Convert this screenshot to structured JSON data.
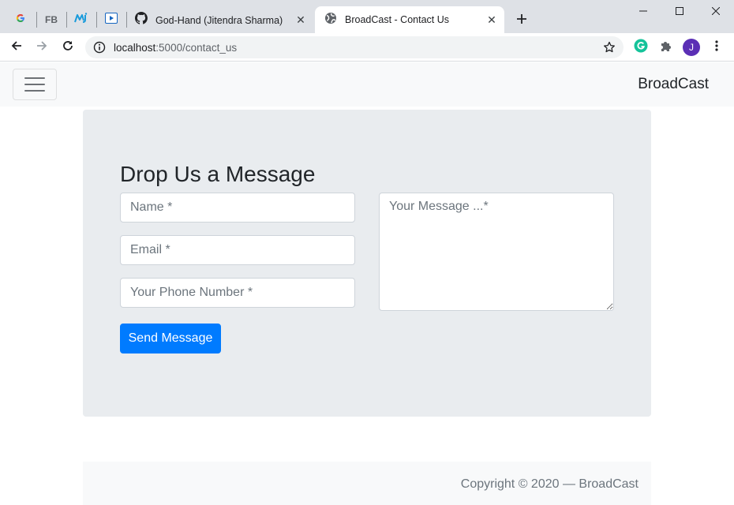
{
  "browser": {
    "pinned_tabs": [
      {
        "name": "google-tab-icon",
        "glyph": "G"
      },
      {
        "name": "fb-tab-icon",
        "glyph": "FB"
      },
      {
        "name": "mj-tab-icon",
        "glyph": "mj"
      },
      {
        "name": "video-tab-icon",
        "glyph": "▶"
      }
    ],
    "tabs": [
      {
        "title": "God-Hand (Jitendra Sharma)",
        "icon": "github-icon",
        "active": false
      },
      {
        "title": "BroadCast - Contact Us",
        "icon": "globe-icon",
        "active": true
      }
    ],
    "address": {
      "host": "localhost",
      "rest": ":5000/contact_us"
    },
    "profile_initial": "J",
    "colors": {
      "tabstrip": "#dee1e6",
      "accent_profile": "#5b2fb5",
      "grammarly": "#15c39a"
    }
  },
  "navbar": {
    "brand": "BroadCast"
  },
  "form": {
    "heading": "Drop Us a Message",
    "name_placeholder": "Name *",
    "email_placeholder": "Email *",
    "phone_placeholder": "Your Phone Number *",
    "message_placeholder": "Your Message ...*",
    "submit_label": "Send Message",
    "colors": {
      "primary": "#007bff",
      "jumbotron": "#e9ecef"
    }
  },
  "footer": {
    "copyright": "Copyright © 2020 — BroadCast"
  }
}
